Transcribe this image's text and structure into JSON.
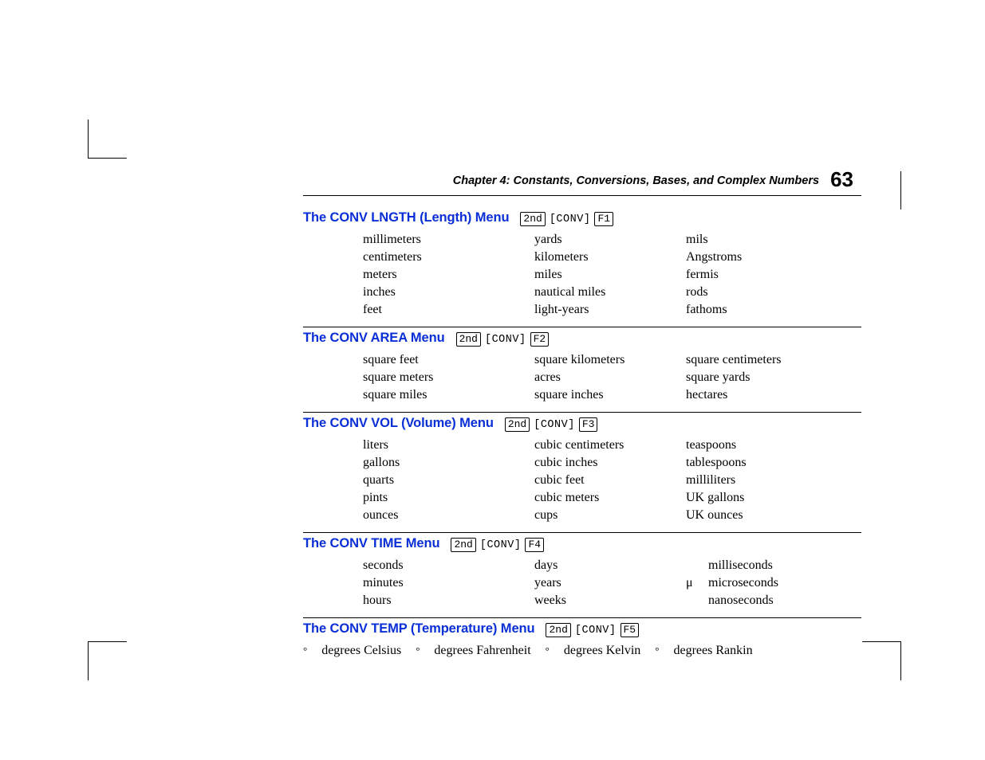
{
  "header": {
    "chapter_label": "Chapter 4:  Constants, Conversions, Bases, and Complex Numbers",
    "page_number": "63"
  },
  "keys": {
    "second": "2nd",
    "conv": "[CONV]",
    "f1": "F1",
    "f2": "F2",
    "f3": "F3",
    "f4": "F4",
    "f5": "F5"
  },
  "sections": [
    {
      "title": "The CONV LNGTH (Length) Menu",
      "fkey": "f1",
      "columns": [
        [
          "millimeters",
          "centimeters",
          "meters",
          "inches",
          "feet"
        ],
        [
          "yards",
          "kilometers",
          "miles",
          "nautical miles",
          "light-years"
        ],
        [
          "mils",
          "Angstroms",
          "fermis",
          "rods",
          "fathoms"
        ]
      ]
    },
    {
      "title": "The CONV AREA Menu",
      "fkey": "f2",
      "columns": [
        [
          "square feet",
          "square meters",
          "square miles"
        ],
        [
          "square kilometers",
          "acres",
          "square inches"
        ],
        [
          "square centimeters",
          "square yards",
          "hectares"
        ]
      ]
    },
    {
      "title": "The CONV VOL (Volume) Menu",
      "fkey": "f3",
      "columns": [
        [
          "liters",
          "gallons",
          "quarts",
          "pints",
          "ounces"
        ],
        [
          "cubic centimeters",
          "cubic inches",
          "cubic feet",
          "cubic meters",
          "cups"
        ],
        [
          "teaspoons",
          "tablespoons",
          "milliliters",
          "UK gallons",
          "UK ounces"
        ]
      ]
    },
    {
      "title": "The CONV TIME Menu",
      "fkey": "f4",
      "columns": [
        [
          "seconds",
          "minutes",
          "hours"
        ],
        [
          "days",
          "years",
          "weeks"
        ],
        [
          "milliseconds",
          "microseconds",
          "nanoseconds"
        ]
      ],
      "col3_prefix": [
        "",
        "μ",
        ""
      ]
    },
    {
      "title": "The CONV TEMP (Temperature) Menu",
      "fkey": "f5",
      "temp_cells": [
        {
          "symbol": "°",
          "label": "degrees Celsius"
        },
        {
          "symbol": "°",
          "label": "degrees Fahrenheit"
        },
        {
          "symbol": "°",
          "label": "degrees Kelvin"
        },
        {
          "symbol": "°",
          "label": "degrees Rankin"
        }
      ]
    }
  ]
}
